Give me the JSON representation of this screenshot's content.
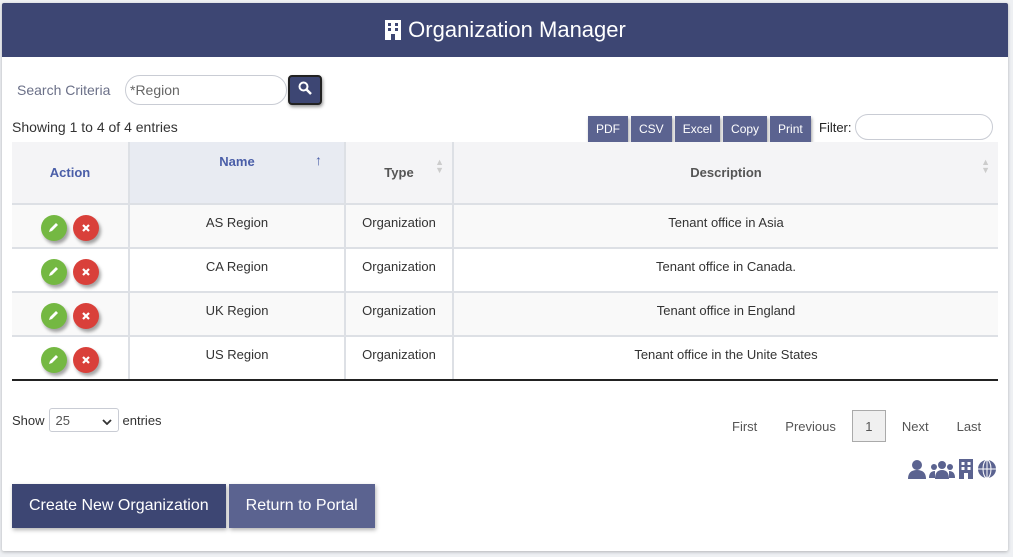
{
  "header": {
    "title": "Organization Manager",
    "icon": "building-icon"
  },
  "search": {
    "label": "Search Criteria",
    "placeholder": "*Region",
    "value": ""
  },
  "table_info": {
    "showing": "Showing 1 to 4 of 4 entries"
  },
  "export": {
    "pdf": "PDF",
    "csv": "CSV",
    "excel": "Excel",
    "copy": "Copy",
    "print": "Print"
  },
  "filter": {
    "label": "Filter:",
    "value": ""
  },
  "columns": {
    "action": "Action",
    "name": "Name",
    "type": "Type",
    "description": "Description"
  },
  "sort_indicator": "↑",
  "rows": [
    {
      "name": "AS Region",
      "type": "Organization",
      "description": "Tenant office in Asia"
    },
    {
      "name": "CA Region",
      "type": "Organization",
      "description": "Tenant office in Canada."
    },
    {
      "name": "UK Region",
      "type": "Organization",
      "description": "Tenant office in England"
    },
    {
      "name": "US Region",
      "type": "Organization",
      "description": "Tenant office in the Unite States"
    }
  ],
  "length": {
    "show": "Show",
    "value": "25",
    "entries": "entries"
  },
  "pager": {
    "first": "First",
    "previous": "Previous",
    "current": "1",
    "next": "Next",
    "last": "Last"
  },
  "nav_icons": [
    "user-icon",
    "users-icon",
    "building-icon",
    "globe-icon"
  ],
  "buttons": {
    "create": "Create New Organization",
    "return": "Return to Portal"
  },
  "colors": {
    "brand": "#3d4673",
    "secondary": "#5b6390",
    "edit": "#74b842",
    "delete": "#d9403a"
  }
}
